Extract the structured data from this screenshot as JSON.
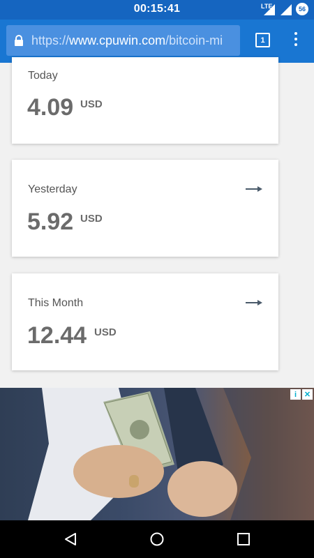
{
  "status_bar": {
    "time": "00:15:41",
    "network": "LTE",
    "battery_badge": "56"
  },
  "browser": {
    "url_scheme": "https://",
    "url_host": "www.cpuwin.com",
    "url_path": "/bitcoin-mi",
    "tab_count": "1"
  },
  "cards": [
    {
      "label": "Today",
      "value": "4.09",
      "unit": "USD"
    },
    {
      "label": "Yesterday",
      "value": "5.92",
      "unit": "USD"
    },
    {
      "label": "This Month",
      "value": "12.44",
      "unit": "USD"
    }
  ],
  "ad": {
    "description_icon": "info-icon",
    "close_icon": "close-icon"
  },
  "colors": {
    "status_bar": "#1565c0",
    "toolbar": "#1976d2",
    "url_box": "#4a90e0",
    "value_text": "#6b6b6b",
    "arrow": "#4a5a6a"
  }
}
